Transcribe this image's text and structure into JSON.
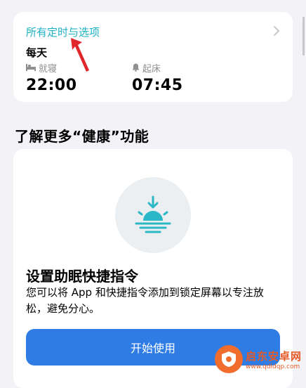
{
  "schedule": {
    "link_label": "所有定时与选项",
    "frequency": "每天",
    "bedtime_label": "就寝",
    "bedtime_value": "22:00",
    "wake_label": "起床",
    "wake_value": "07:45"
  },
  "section": {
    "title": "了解更多“健康”功能"
  },
  "feature": {
    "title": "设置助眠快捷指令",
    "description": "您可以将 App 和快捷指令添加到锁定屏幕以专注放松，避免分心。",
    "cta_label": "开始使用"
  },
  "watermark": {
    "name": "启东安卓网",
    "url": "www.qdldqp.com"
  },
  "colors": {
    "accent_link": "#1fb1c4",
    "cta_blue": "#2e7ce4",
    "annotation_red": "#e0252b",
    "sunset_teal": "#2cb7c7"
  },
  "icons": {
    "bed": "bed-icon",
    "bell": "bell-icon",
    "chevron": "chevron-right-icon",
    "sunset": "sunset-icon"
  }
}
